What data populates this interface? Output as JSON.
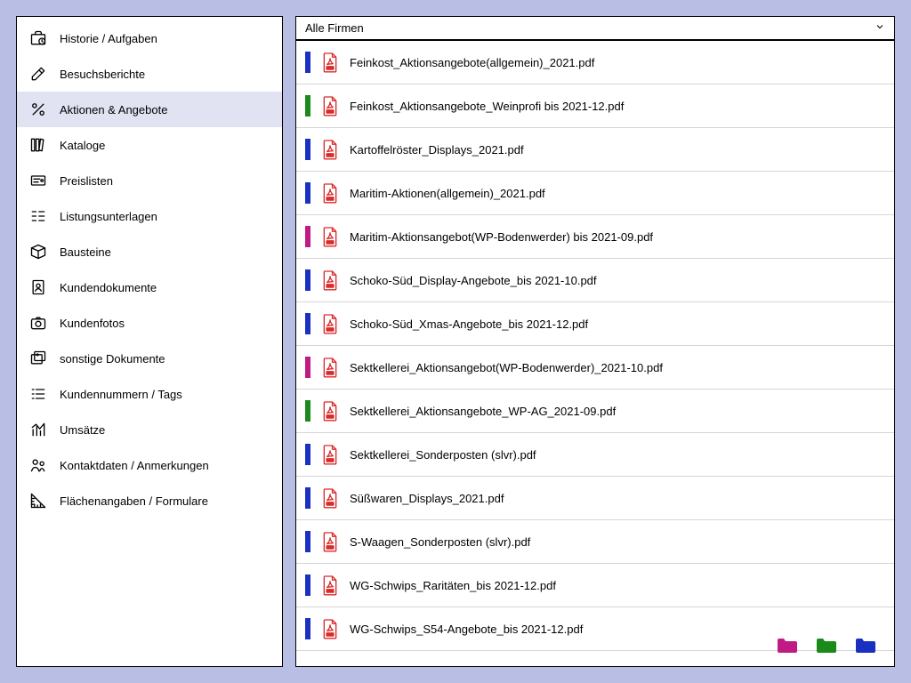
{
  "sidebar": {
    "items": [
      {
        "label": "Historie / Aufgaben",
        "icon": "briefcase-clock",
        "selected": false
      },
      {
        "label": "Besuchsberichte",
        "icon": "edit-note",
        "selected": false
      },
      {
        "label": "Aktionen & Angebote",
        "icon": "percent",
        "selected": true
      },
      {
        "label": "Kataloge",
        "icon": "books",
        "selected": false
      },
      {
        "label": "Preislisten",
        "icon": "price-tag",
        "selected": false
      },
      {
        "label": "Listungsunterlagen",
        "icon": "list-lines",
        "selected": false
      },
      {
        "label": "Bausteine",
        "icon": "box",
        "selected": false
      },
      {
        "label": "Kundendokumente",
        "icon": "user-doc",
        "selected": false
      },
      {
        "label": "Kundenfotos",
        "icon": "camera",
        "selected": false
      },
      {
        "label": "sonstige Dokumente",
        "icon": "images",
        "selected": false
      },
      {
        "label": "Kundennummern / Tags",
        "icon": "tag-list",
        "selected": false
      },
      {
        "label": "Umsätze",
        "icon": "bar-chart",
        "selected": false
      },
      {
        "label": "Kontaktdaten / Anmerkungen",
        "icon": "people",
        "selected": false
      },
      {
        "label": "Flächenangaben / Formulare",
        "icon": "ruler",
        "selected": false
      }
    ]
  },
  "main": {
    "dropdown_label": "Alle Firmen",
    "files": [
      {
        "name": "Feinkost_Aktionsangebote(allgemein)_2021.pdf",
        "color": "blue"
      },
      {
        "name": "Feinkost_Aktionsangebote_Weinprofi bis 2021-12.pdf",
        "color": "green"
      },
      {
        "name": "Kartoffelröster_Displays_2021.pdf",
        "color": "blue"
      },
      {
        "name": "Maritim-Aktionen(allgemein)_2021.pdf",
        "color": "blue"
      },
      {
        "name": "Maritim-Aktionsangebot(WP-Bodenwerder) bis 2021-09.pdf",
        "color": "magenta"
      },
      {
        "name": "Schoko-Süd_Display-Angebote_bis 2021-10.pdf",
        "color": "blue"
      },
      {
        "name": "Schoko-Süd_Xmas-Angebote_bis 2021-12.pdf",
        "color": "blue"
      },
      {
        "name": "Sektkellerei_Aktionsangebot(WP-Bodenwerder)_2021-10.pdf",
        "color": "magenta"
      },
      {
        "name": "Sektkellerei_Aktionsangebote_WP-AG_2021-09.pdf",
        "color": "green"
      },
      {
        "name": "Sektkellerei_Sonderposten (slvr).pdf",
        "color": "blue"
      },
      {
        "name": "Süßwaren_Displays_2021.pdf",
        "color": "blue"
      },
      {
        "name": "S-Waagen_Sonderposten (slvr).pdf",
        "color": "blue"
      },
      {
        "name": "WG-Schwips_Raritäten_bis 2021-12.pdf",
        "color": "blue"
      },
      {
        "name": "WG-Schwips_S54-Angebote_bis 2021-12.pdf",
        "color": "blue"
      }
    ],
    "footer_colors": [
      "magenta",
      "green",
      "blue"
    ]
  },
  "colors": {
    "blue": "#1930c0",
    "green": "#1a8a1a",
    "magenta": "#c01b85"
  }
}
